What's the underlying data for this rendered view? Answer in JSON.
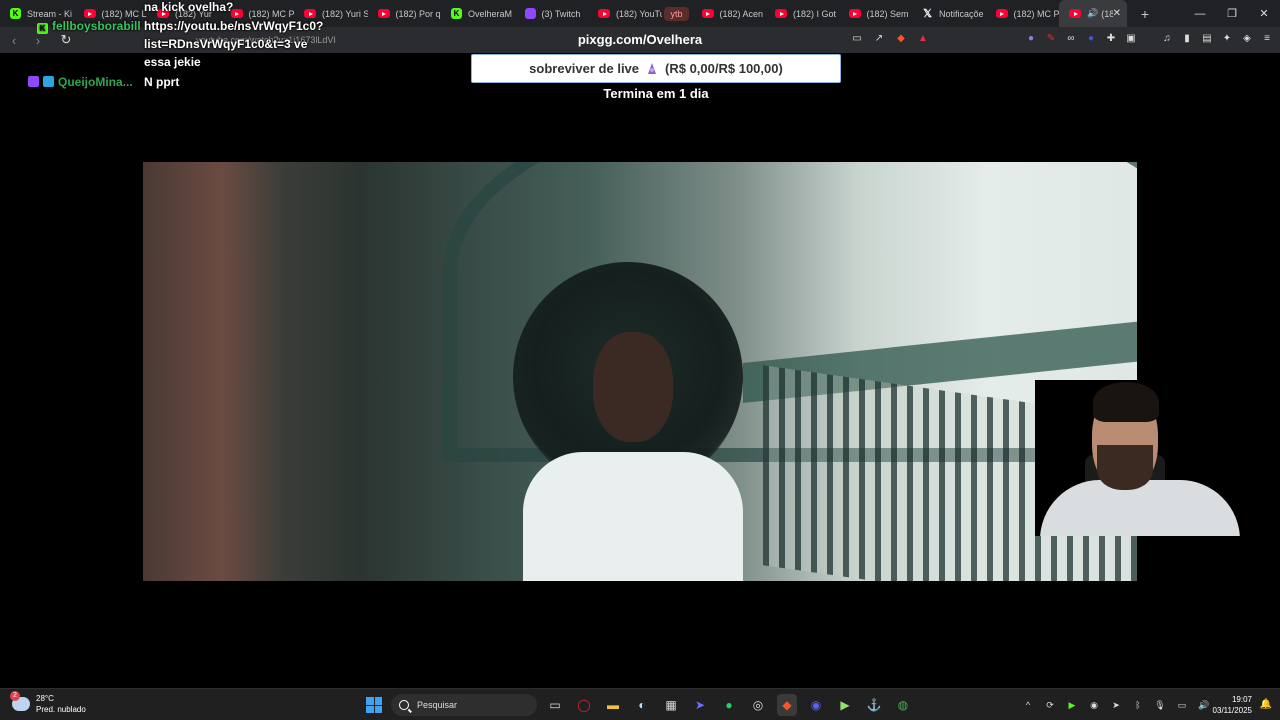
{
  "tabs": [
    {
      "title": "Stream - Ki",
      "favicon": "kick"
    },
    {
      "title": "(182) MC L",
      "favicon": "youtube"
    },
    {
      "title": "(182) Yur",
      "favicon": "youtube"
    },
    {
      "title": "(182) MC P",
      "favicon": "youtube"
    },
    {
      "title": "(182) Yuri S",
      "favicon": "youtube"
    },
    {
      "title": "(182) Por q",
      "favicon": "youtube"
    },
    {
      "title": "OvelheraM",
      "favicon": "kick"
    },
    {
      "title": "(3) Twitch",
      "favicon": "twitch"
    },
    {
      "title": "(182) YouTu",
      "favicon": "youtube"
    }
  ],
  "tab_group_label": "ytb",
  "tabs2": [
    {
      "title": "(182) Acen",
      "favicon": "youtube"
    },
    {
      "title": "(182) I Got",
      "favicon": "youtube"
    },
    {
      "title": "(182) Sem",
      "favicon": "youtube"
    },
    {
      "title": "Notificaçõe",
      "favicon": "x"
    },
    {
      "title": "(182) MC P",
      "favicon": "youtube"
    }
  ],
  "active_tab": {
    "title": "(18",
    "favicon": "youtube"
  },
  "address": {
    "url": "pixgg.com/Ovelhera",
    "ghost_url": "youtube.com/watch?v=1i1673lLdVI"
  },
  "chat": {
    "msg1_text": "na kick ovelha?",
    "user2": "fellboysborabill",
    "msg2_line1": "https://youtu.be/nsVrWqyF1c0?",
    "msg2_line2": "list=RDnsVrWqyF1c0&t=3 ve",
    "msg2_line3": "essa jekie",
    "user3": "QueijoMina...",
    "msg3_text": "N pprt"
  },
  "goal": {
    "label": "sobreviver de live",
    "amount": "(R$ 0,00/R$ 100,00)",
    "ends": "Termina em 1 dia"
  },
  "taskbar": {
    "weather_temp": "28°C",
    "weather_desc": "Pred. nublado",
    "weather_badge": "2",
    "search_placeholder": "Pesquisar",
    "time": "19:07",
    "date": "03/11/2025"
  }
}
